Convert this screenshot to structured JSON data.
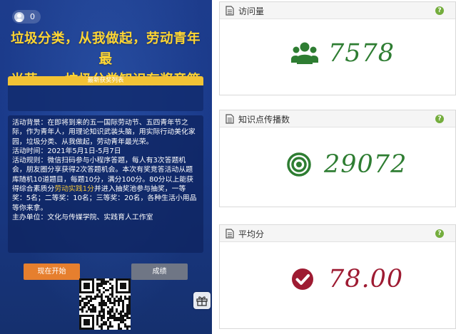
{
  "phone": {
    "user_count": "0",
    "title_line1": "垃圾分类，从我做起，劳动青年最",
    "title_line2": "光荣——垃圾分类知识有奖竞答",
    "winners_header": "最新获奖列表",
    "info": {
      "background": "活动背景：在即将到来的五一国际劳动节、五四青年节之际，作为青年人，用理论知识武装头脑，用实际行动美化家园，垃圾分类、从我做起，劳动青年最光荣。",
      "time": "活动时间：2021年5月1日-5月7日",
      "rules_before": "活动规则：微信扫码参与小程序答题，每人有3次答题机会，朋友圈分享获得2次答题机会。本次有奖竞答活动从题库随机10道题目，每题10分，满分100分。80分以上能获得综合素质分",
      "rules_highlight": "劳动实践1分",
      "rules_after": "并进入抽奖池参与抽奖，一等奖：5名；二等奖：10名；三等奖：20名，各种生活小用品等你来拿。",
      "organizer": "主办单位：文化与传媒学院、实践育人工作室"
    },
    "start_button": "现在开始",
    "score_button": "成绩"
  },
  "cards": [
    {
      "label": "访问量",
      "value": "7578",
      "icon": "users-icon",
      "color": "#2e7d32"
    },
    {
      "label": "知识点传播数",
      "value": "29072",
      "icon": "bullseye-icon",
      "color": "#2e7d32"
    },
    {
      "label": "平均分",
      "value": "78.00",
      "icon": "check-circle-icon",
      "color": "#9e1b32"
    }
  ],
  "help_glyph": "?"
}
